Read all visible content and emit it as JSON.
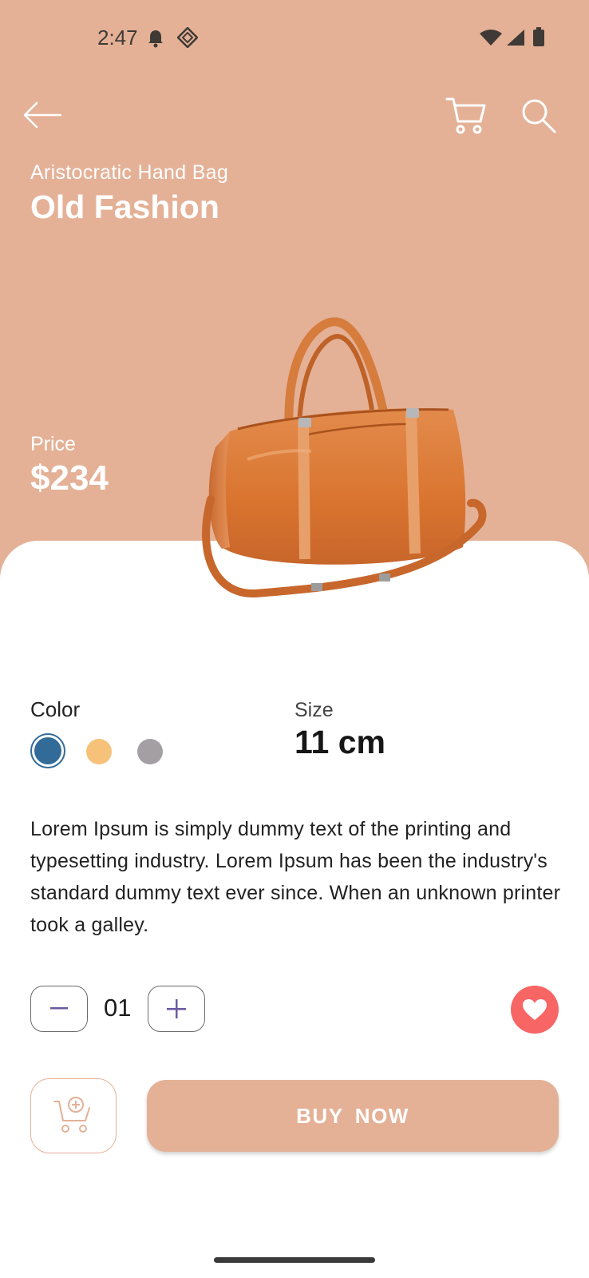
{
  "status_bar": {
    "time": "2:47"
  },
  "product": {
    "subtitle": "Aristocratic Hand Bag",
    "title": "Old Fashion",
    "price_label": "Price",
    "price": "$234",
    "color_label": "Color",
    "colors": [
      "#336b98",
      "#f6c27a",
      "#a49fa3"
    ],
    "selected_color_index": 0,
    "size_label": "Size",
    "size_value": "11 cm",
    "description": "Lorem Ipsum is simply dummy text of the printing and typesetting industry. Lorem Ipsum has been the industry's standard dummy text ever since. When an unknown printer took a galley."
  },
  "quantity": {
    "value": "01"
  },
  "actions": {
    "buy_label": "BUY  NOW"
  },
  "theme": {
    "accent": "#e4b197",
    "favorite": "#f76565"
  }
}
